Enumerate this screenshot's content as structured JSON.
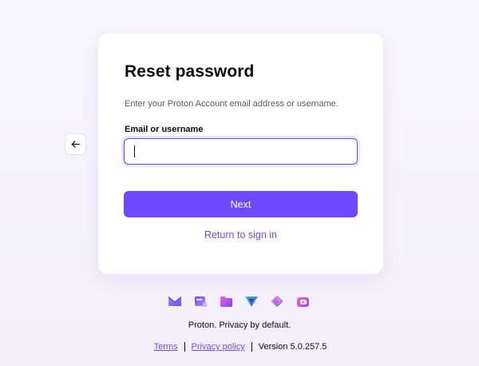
{
  "nav": {
    "back_icon": "arrow-left-icon"
  },
  "card": {
    "title": "Reset password",
    "subtitle": "Enter your Proton Account email address or username.",
    "field_label": "Email or username",
    "field_value": "",
    "field_placeholder": "",
    "next_label": "Next",
    "return_label": "Return to sign in"
  },
  "apps": [
    {
      "name": "proton-mail-icon"
    },
    {
      "name": "proton-calendar-icon"
    },
    {
      "name": "proton-drive-icon"
    },
    {
      "name": "proton-vpn-icon"
    },
    {
      "name": "proton-pass-icon"
    },
    {
      "name": "proton-wallet-icon"
    }
  ],
  "footer": {
    "tagline": "Proton. Privacy by default.",
    "terms": "Terms",
    "privacy": "Privacy policy",
    "version": "Version 5.0.257.5"
  },
  "colors": {
    "accent": "#6d4aff",
    "background": "#f5f3fc",
    "card": "#ffffff"
  }
}
